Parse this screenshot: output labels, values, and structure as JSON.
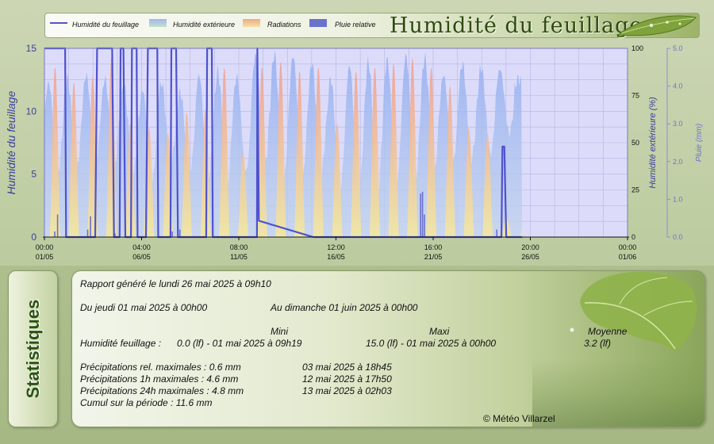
{
  "chart_data": {
    "type": "line",
    "title": "Humidité du feuillage",
    "legend": {
      "placement": "top",
      "entries": [
        {
          "name": "Humidité du feuillage",
          "color": "#5055cc",
          "kind": "line"
        },
        {
          "name": "Humidité extérieure",
          "color": "#a9bff0",
          "kind": "area"
        },
        {
          "name": "Radiations",
          "color": "#f0a88a",
          "kind": "area"
        },
        {
          "name": "Pluie relative",
          "color": "#5862c8",
          "kind": "area"
        }
      ]
    },
    "ylabel_left": "Humidité du feuillage",
    "ylabel_right": "Humidité extérieure (%)",
    "ylabel_right2": "Pluie (mm)",
    "ylim_left": [
      0,
      15
    ],
    "ylim_right": [
      0,
      100
    ],
    "ylim_right2": [
      0,
      5
    ],
    "yticks_left": [
      "0",
      "5",
      "10",
      "15"
    ],
    "yticks_right": [
      "0",
      "25",
      "50",
      "75",
      "100"
    ],
    "yticks_right2": [
      "0.0",
      "1.0",
      "2.0",
      "3.0",
      "4.0",
      "5.0"
    ],
    "x_ticks": [
      {
        "time": "00:00",
        "date": "01/05"
      },
      {
        "time": "04:00",
        "date": "06/05"
      },
      {
        "time": "08:00",
        "date": "11/05"
      },
      {
        "time": "12:00",
        "date": "16/05"
      },
      {
        "time": "16:00",
        "date": "21/05"
      },
      {
        "time": "20:00",
        "date": "26/05"
      },
      {
        "time": "00:00",
        "date": "01/06"
      }
    ],
    "x_range_days": [
      0,
      31
    ],
    "grid": true,
    "data_end_day": 25.4,
    "series": [
      {
        "name": "Humidité du feuillage",
        "unit": "lf",
        "points": [
          [
            0,
            15
          ],
          [
            1.1,
            15
          ],
          [
            1.15,
            0
          ],
          [
            2.7,
            0
          ],
          [
            2.8,
            15
          ],
          [
            3.6,
            15
          ],
          [
            3.7,
            0
          ],
          [
            4.0,
            0
          ],
          [
            4.05,
            15
          ],
          [
            4.2,
            15
          ],
          [
            4.3,
            0
          ],
          [
            4.6,
            0
          ],
          [
            4.65,
            15
          ],
          [
            4.9,
            15
          ],
          [
            4.95,
            0
          ],
          [
            5.4,
            0
          ],
          [
            5.5,
            15
          ],
          [
            6.0,
            15
          ],
          [
            6.05,
            0
          ],
          [
            6.7,
            0
          ],
          [
            6.75,
            15
          ],
          [
            7.0,
            15
          ],
          [
            7.1,
            0
          ],
          [
            8.6,
            0
          ],
          [
            8.65,
            15
          ],
          [
            8.9,
            15
          ],
          [
            8.95,
            0
          ],
          [
            11.3,
            0
          ],
          [
            11.32,
            15
          ],
          [
            11.4,
            1.3
          ],
          [
            14.3,
            0
          ],
          [
            24.3,
            0
          ],
          [
            24.35,
            7.2
          ],
          [
            24.45,
            7.2
          ],
          [
            24.55,
            0
          ],
          [
            25.4,
            0
          ]
        ]
      },
      {
        "name": "Humidité extérieure",
        "unit": "%",
        "daily": [
          {
            "min": 35,
            "max": 82
          },
          {
            "min": 37,
            "max": 84
          },
          {
            "min": 38,
            "max": 86
          },
          {
            "min": 36,
            "max": 84
          },
          {
            "min": 34,
            "max": 80
          },
          {
            "min": 30,
            "max": 78
          },
          {
            "min": 38,
            "max": 82
          },
          {
            "min": 34,
            "max": 77
          },
          {
            "min": 32,
            "max": 86
          },
          {
            "min": 28,
            "max": 88
          },
          {
            "min": 35,
            "max": 85
          },
          {
            "min": 38,
            "max": 96
          },
          {
            "min": 30,
            "max": 97
          },
          {
            "min": 32,
            "max": 96
          },
          {
            "min": 33,
            "max": 92
          },
          {
            "min": 26,
            "max": 84
          },
          {
            "min": 24,
            "max": 91
          },
          {
            "min": 25,
            "max": 93
          },
          {
            "min": 28,
            "max": 94
          },
          {
            "min": 30,
            "max": 96
          },
          {
            "min": 34,
            "max": 95
          },
          {
            "min": 40,
            "max": 86
          },
          {
            "min": 42,
            "max": 92
          },
          {
            "min": 44,
            "max": 90
          },
          {
            "min": 55,
            "max": 89
          },
          {
            "min": 72,
            "max": 84
          }
        ]
      },
      {
        "name": "Radiations",
        "daily_peak_fraction": [
          0.9,
          0.82,
          0.85,
          0.95,
          0.6,
          0.58,
          0.55,
          0.66,
          0.68,
          0.9,
          0.45,
          0.9,
          0.93,
          0.88,
          0.9,
          0.6,
          0.88,
          0.9,
          0.92,
          0.95,
          0.9,
          0.8,
          0.58,
          0.55,
          0.1
        ]
      },
      {
        "name": "Pluie relative",
        "unit": "mm",
        "points": [
          [
            0.55,
            0.15
          ],
          [
            0.7,
            0.6
          ],
          [
            2.3,
            0.2
          ],
          [
            2.45,
            0.55
          ],
          [
            3.7,
            0.5
          ],
          [
            3.75,
            0.1
          ],
          [
            6.8,
            0.15
          ],
          [
            7.2,
            0.2
          ],
          [
            20.0,
            1.15
          ],
          [
            20.1,
            1.2
          ],
          [
            20.2,
            0.6
          ],
          [
            24.05,
            0.2
          ]
        ]
      }
    ]
  },
  "legend_titles": {
    "foliage": "Humidité du feuillage",
    "ext": "Humidité extérieure",
    "rad": "Radiations",
    "rain": "Pluie relative"
  },
  "stats": {
    "tab_label": "Statistiques",
    "report_line": "Rapport généré le lundi 26 mai 2025 à 09h10",
    "period_from": "Du jeudi 01 mai 2025 à 00h00",
    "period_to": "Au dimanche 01 juin 2025 à 00h00",
    "col_min": "Mini",
    "col_max": "Maxi",
    "col_avg": "Moyenne",
    "foliage_label": "Humidité feuillage :",
    "foliage_min": "0.0 (lf) - 01 mai 2025 à 09h19",
    "foliage_max": "15.0 (lf) - 01 mai 2025 à 00h00",
    "foliage_avg": "3.2 (lf)",
    "precip": [
      {
        "label": "Précipitations rel. maximales : 0.6 mm",
        "date": "03 mai 2025 à 18h45"
      },
      {
        "label": "Précipitations 1h maximales : 4.6 mm",
        "date": "12 mai 2025 à 17h50"
      },
      {
        "label": "Précipitations 24h maximales : 4.8 mm",
        "date": "13 mai 2025 à 02h03"
      }
    ],
    "cumul": "Cumul sur la période : 11.6 mm",
    "copyright": "© Météo Villarzel"
  }
}
